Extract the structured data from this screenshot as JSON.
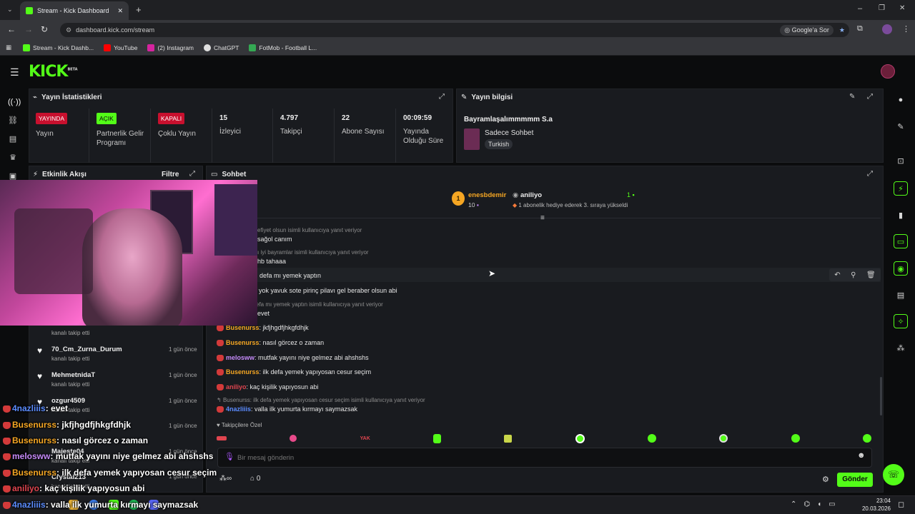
{
  "browser": {
    "tab_title": "Stream - Kick Dashboard",
    "url": "dashboard.kick.com/stream",
    "google_search_label": "Google'a Sor",
    "bookmarks": [
      {
        "label": "Stream - Kick Dashb...",
        "color": "#53fc18"
      },
      {
        "label": "YouTube",
        "color": "#ff0000"
      },
      {
        "label": "(2) Instagram",
        "color": "#d6249f"
      },
      {
        "label": "ChatGPT",
        "color": "#e0e0e0"
      },
      {
        "label": "FotMob - Football L...",
        "color": "#34a853"
      }
    ]
  },
  "kick": {
    "logo": "KICK",
    "beta": "BETA"
  },
  "stats_panel": {
    "title": "Yayın İstatistikleri",
    "items": [
      {
        "badge": "YAYINDA",
        "label": "Yayın"
      },
      {
        "badge": "AÇIK",
        "label": "Partnerlik Gelir Programı"
      },
      {
        "badge": "KAPALI",
        "label": "Çoklu Yayın"
      },
      {
        "value": "15",
        "label": "İzleyici"
      },
      {
        "value": "4.797",
        "label": "Takipçi"
      },
      {
        "value": "22",
        "label": "Abone Sayısı"
      },
      {
        "value": "00:09:59",
        "label": "Yayında Olduğu Süre"
      }
    ]
  },
  "info_panel": {
    "title": "Yayın bilgisi",
    "stream_title": "Bayramlaşalımmmmm S.a",
    "category": "Sadece Sohbet",
    "language_tag": "Turkish"
  },
  "activity_panel": {
    "title": "Etkinlik Akışı",
    "filter_label": "Filtre",
    "events": [
      {
        "name": "",
        "sub": "kanalı takip etti",
        "time": ""
      },
      {
        "name": "70_Cm_Zurna_Durum",
        "sub": "kanalı takip etti",
        "time": "1 gün önce"
      },
      {
        "name": "MehmetnidaT",
        "sub": "kanalı takip etti",
        "time": "1 gün önce"
      },
      {
        "name": "ozgur4509",
        "sub": "kanalı takip etti",
        "time": "1 gün önce"
      },
      {
        "name": "",
        "sub": "",
        "time": "1 gün önce"
      },
      {
        "name": "Majeste04",
        "sub": "kanalı takip etti",
        "time": "1 gün önce"
      },
      {
        "name": "Crystal213",
        "sub": "kanalı takip etti",
        "time": "1 gün önce"
      }
    ]
  },
  "chat_panel": {
    "title": "Sohbet",
    "pinned": {
      "gifter": "enesbdemir",
      "gifter_count": "10",
      "rank": "1",
      "recipient": "aniliyo",
      "recipient_count": "1",
      "message": "1 abonelik hediye ederek 3. sıraya yükseldi"
    },
    "lines": [
      {
        "reply": "efiyet olsun isimli kullanıcıya yanıt veriyor"
      },
      {
        "text": "sağol canım"
      },
      {
        "reply": "ı iyi bayramlar isimli kullanıcıya yanıt veriyor"
      },
      {
        "text": "hb tahaaa"
      },
      {
        "text": ": defa mı yemek yaptın"
      },
      {
        "text": ": yok yavuk sote pirinç pilavı gel beraber olsun abi"
      },
      {
        "reply": "efa mı yemek yaptın isimli kullanıcıya yanıt veriyor"
      },
      {
        "text": "evet"
      },
      {
        "user": "Busenurss",
        "color": "#f5a623",
        "text": ": jkfjhgdfjhkgfdhjk"
      },
      {
        "user": "Busenurss",
        "color": "#f5a623",
        "text": ": nasıl görcez o zaman"
      },
      {
        "user": "melosww",
        "color": "#c58af9",
        "text": ": mutfak yayını niye gelmez abi ahshshs"
      },
      {
        "user": "Busenurss",
        "color": "#f5a623",
        "text": ": ilk defa yemek yapıyosan cesur seçim"
      },
      {
        "user": "aniliyo",
        "color": "#e0454f",
        "text": ": kaç kişilik yapıyosun abi"
      },
      {
        "reply": "Busenurss: ilk defa yemek yapıyosan cesur seçim isimli kullanıcıya yanıt veriyor"
      },
      {
        "user": "4nazliiis",
        "color": "#5b8cff",
        "text": ": valla ilk yumurta kırmayı saymazsak"
      }
    ],
    "followers_only_label": "Takipçilere Özel",
    "input_placeholder": "Bir mesaj gönderin",
    "points": "0",
    "send_label": "Gönder"
  },
  "stream_overlay": [
    {
      "user": "4nazliiis",
      "color": "#5b8cff",
      "text": ": evet"
    },
    {
      "user": "Busenurss",
      "color": "#f5a623",
      "text": ": jkfjhgdfjhkgfdhjk"
    },
    {
      "user": "Busenurss",
      "color": "#f5a623",
      "text": ": nasıl görcez o zaman"
    },
    {
      "user": "melosww",
      "color": "#c58af9",
      "text": ": mutfak yayını niye gelmez abi ahshshs"
    },
    {
      "user": "Busenurss",
      "color": "#f5a623",
      "text": ": ilk defa yemek yapıyosan cesur seçim"
    },
    {
      "user": "aniliyo",
      "color": "#e0454f",
      "text": ": kaç kişilik yapıyosun abi"
    },
    {
      "user": "4nazliiis",
      "color": "#5b8cff",
      "text": ": valla ilk yumurta kırmayı saymazsak"
    }
  ],
  "taskbar": {
    "time": "23:04",
    "date": "20.03.2026"
  }
}
